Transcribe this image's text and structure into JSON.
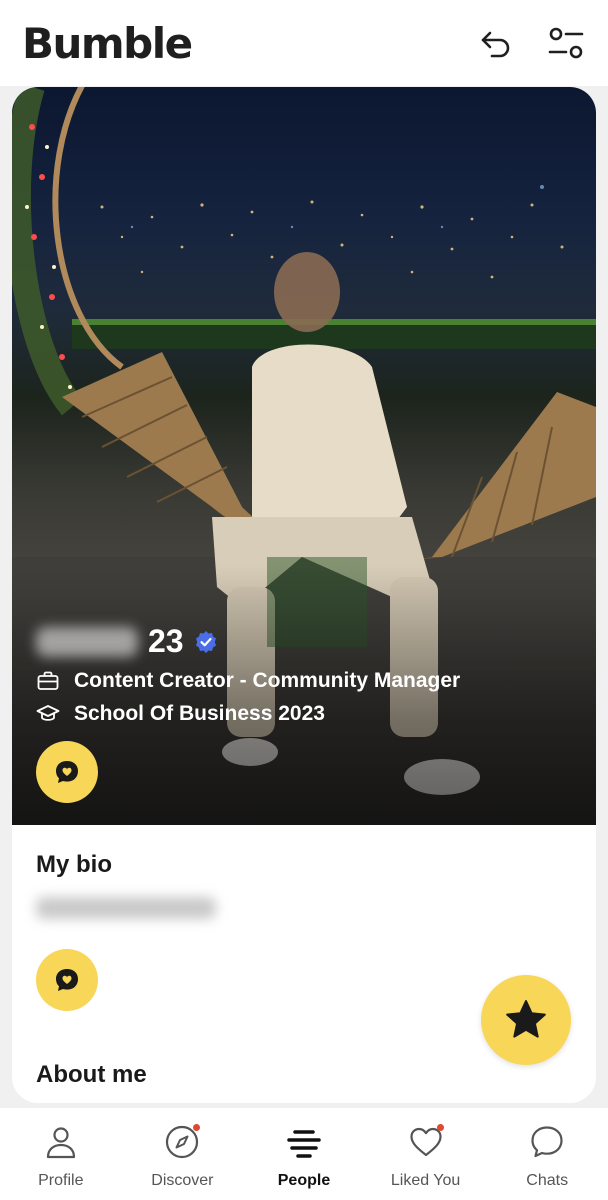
{
  "app": {
    "brand": "Bumble"
  },
  "header": {
    "actions": [
      {
        "icon": "undo-icon"
      },
      {
        "icon": "filters-icon"
      }
    ]
  },
  "profile": {
    "age": "23",
    "verified": true,
    "job": "Content Creator - Community Manager",
    "education": "School Of Business 2023",
    "bio_title": "My bio",
    "about_title": "About me"
  },
  "nav": {
    "items": [
      {
        "label": "Profile",
        "icon": "profile-icon",
        "active": false,
        "badge": false
      },
      {
        "label": "Discover",
        "icon": "compass-icon",
        "active": false,
        "badge": true
      },
      {
        "label": "People",
        "icon": "people-stack-icon",
        "active": true,
        "badge": false
      },
      {
        "label": "Liked You",
        "icon": "heart-icon",
        "active": false,
        "badge": true
      },
      {
        "label": "Chats",
        "icon": "chat-icon",
        "active": false,
        "badge": false
      }
    ]
  },
  "colors": {
    "accent": "#f7d658",
    "verified": "#4b6ee8",
    "badge": "#e0482f"
  }
}
